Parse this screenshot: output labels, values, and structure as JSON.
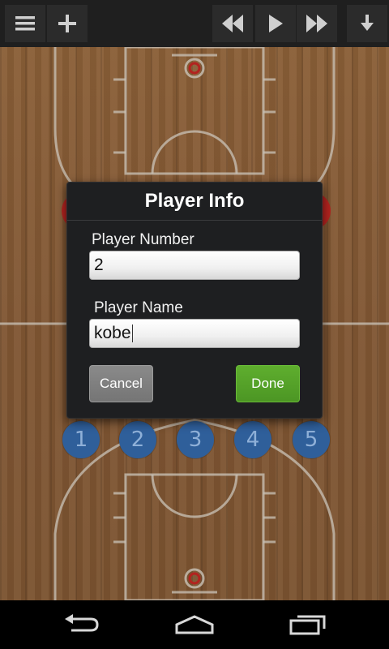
{
  "toolbar": {
    "icons": [
      "menu-icon",
      "add-icon",
      "rewind-icon",
      "play-icon",
      "fast-forward-icon",
      "download-icon"
    ]
  },
  "court": {
    "players": [
      "1",
      "2",
      "3",
      "4",
      "5"
    ],
    "player_color": "#2f5f9a",
    "opponent_color": "#b2231f"
  },
  "dialog": {
    "title": "Player Info",
    "number_label": "Player Number",
    "number_value": "2",
    "name_label": "Player Name",
    "name_value": "kobe",
    "cancel_label": "Cancel",
    "done_label": "Done",
    "done_color": "#56a32a"
  },
  "navbar": {
    "icons": [
      "back-icon",
      "home-icon",
      "recent-apps-icon"
    ]
  }
}
